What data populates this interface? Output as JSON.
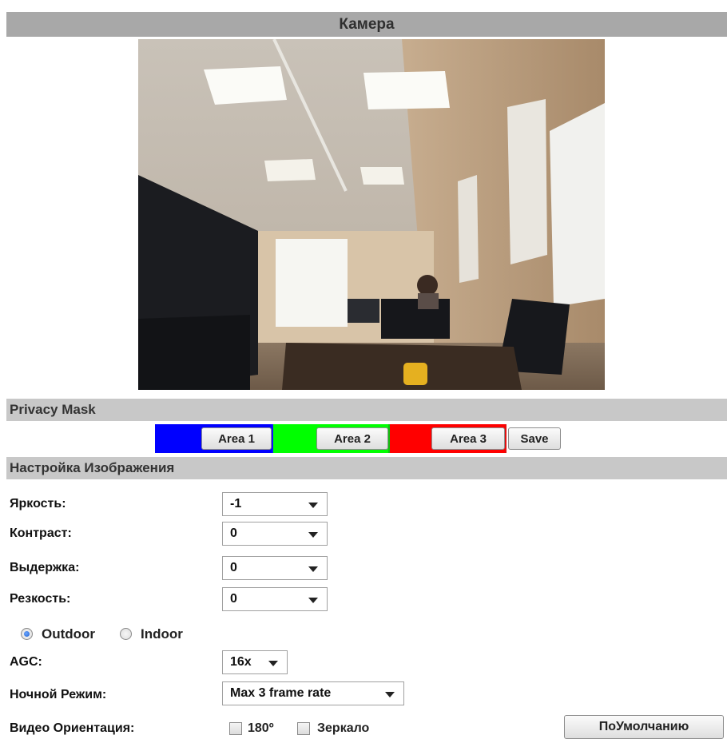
{
  "header": {
    "title": "Камера"
  },
  "privacy": {
    "title": "Privacy Mask",
    "area1": "Area 1",
    "area2": "Area 2",
    "area3": "Area 3",
    "save": "Save",
    "colors": {
      "area1": "#0000ff",
      "area2": "#00ff00",
      "area3": "#ff0000"
    }
  },
  "image_settings": {
    "title": "Настройка Изображения",
    "brightness_label": "Яркость:",
    "brightness_value": "-1",
    "contrast_label": "Контраст:",
    "contrast_value": "0",
    "exposure_label": "Выдержка:",
    "exposure_value": "0",
    "sharpness_label": "Резкость:",
    "sharpness_value": "0",
    "outdoor_label": "Outdoor",
    "indoor_label": "Indoor",
    "mode_selected": "Outdoor",
    "agc_label": "AGC:",
    "agc_value": "16x",
    "night_label": "Ночной Режим:",
    "night_value": "Max 3 frame rate",
    "orientation_label": "Видео Ориентация:",
    "rotate_label": "180º",
    "rotate_checked": false,
    "mirror_label": "Зеркало",
    "mirror_checked": false,
    "default_button": "ПоУмолчанию"
  }
}
